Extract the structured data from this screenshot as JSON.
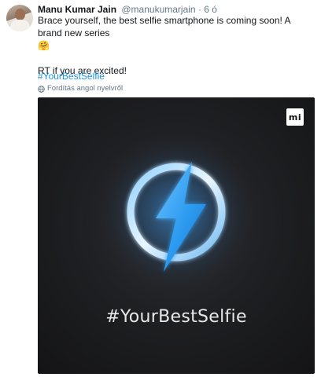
{
  "tweet": {
    "author_name": "Manu Kumar Jain",
    "handle": "@manukumarjain",
    "separator": "·",
    "time": "6 ó",
    "text_line1": "Brace yourself, the best selfie smartphone is coming soon! A brand new series",
    "emoji": "🤗",
    "text_line2": "RT if you are excited!",
    "hashtag": "#YourBestSelfie",
    "translate_label": "Fordítás angol nyelvről",
    "media": {
      "logo_text": "mi",
      "caption": "#YourBestSelfie",
      "colors": {
        "background": "#1c1d20",
        "ring": "#bfe6ff",
        "bolt": "#2d9bf0",
        "glow": "#3aa6ff"
      }
    }
  },
  "colors": {
    "link": "#1b95e0",
    "muted": "#657786",
    "text": "#14171a"
  },
  "icons": {
    "avatar": "user-avatar",
    "translate": "globe-icon",
    "media_logo": "mi-logo-icon",
    "media_art": "lightning-bolt-icon"
  }
}
